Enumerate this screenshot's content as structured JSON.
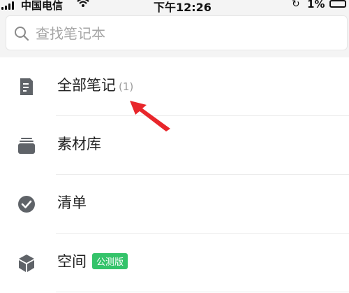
{
  "status_bar": {
    "carrier": "中国电信",
    "time": "下午12:26",
    "battery": "1%"
  },
  "search": {
    "placeholder": "查找笔记本"
  },
  "list": {
    "items": [
      {
        "label": "全部笔记",
        "count": "(1)",
        "icon": "note-document-icon"
      },
      {
        "label": "素材库",
        "icon": "material-library-icon"
      },
      {
        "label": "清单",
        "icon": "checklist-check-icon"
      },
      {
        "label": "空间",
        "badge": "公测版",
        "icon": "space-cube-icon"
      }
    ]
  },
  "colors": {
    "badge": "#34c36a",
    "arrow": "#e8262b",
    "icon": "#5f6368"
  }
}
